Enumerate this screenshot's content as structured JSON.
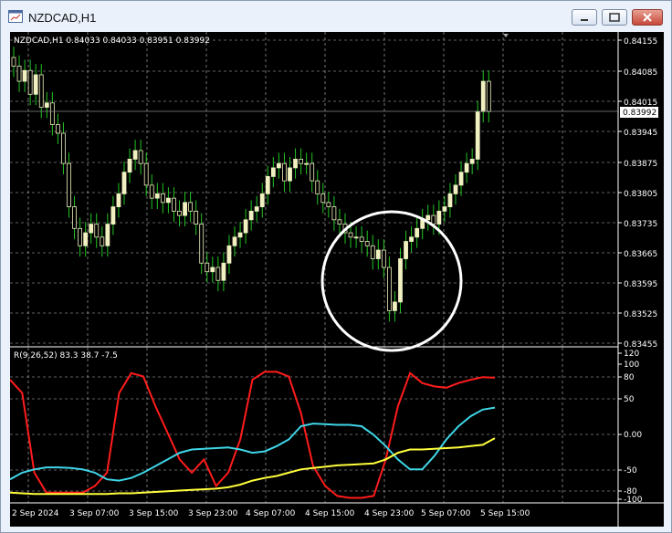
{
  "window": {
    "title": "NZDCAD,H1",
    "icons": {
      "app": "chart-window-icon",
      "minimize": "minimize-icon",
      "maximize": "maximize-icon",
      "close": "close-icon"
    }
  },
  "chart": {
    "header": "NZDCAD,H1  0.84033 0.84033 0.83951 0.83992",
    "price_label": "0.83992",
    "price_ticks": [
      "0.84155",
      "0.84085",
      "0.84015",
      "0.83945",
      "0.83875",
      "0.83805",
      "0.83735",
      "0.83665",
      "0.83595",
      "0.83525",
      "0.83455"
    ],
    "time_ticks": [
      "2 Sep 2024",
      "3 Sep 07:00",
      "3 Sep 15:00",
      "3 Sep 23:00",
      "4 Sep 07:00",
      "4 Sep 15:00",
      "4 Sep 23:00",
      "5 Sep 07:00",
      "5 Sep 15:00"
    ],
    "colors": {
      "background": "#000000",
      "grid": "#c0c0c0",
      "candle": "#f0f0c0",
      "wick": "#22c522",
      "text": "#ffffff"
    }
  },
  "indicator": {
    "label": "R(9,26,52) 83.3 38.7 -7.5",
    "ticks": [
      "120",
      "100",
      "80",
      "50",
      "0.00",
      "-50",
      "-80",
      "-100"
    ],
    "colors": {
      "red": "#ff1c1c",
      "cyan": "#3fd6e8",
      "yellow": "#ffff3c"
    }
  },
  "chart_data": [
    {
      "type": "line",
      "x": [
        0,
        2,
        4,
        6,
        8,
        10,
        12,
        14,
        16,
        18,
        20,
        22,
        24,
        26,
        28,
        30,
        32,
        34,
        36,
        38,
        40,
        42,
        44,
        46,
        48,
        50,
        52,
        54,
        56,
        58,
        60,
        62,
        64,
        66,
        68,
        70,
        72,
        74,
        76,
        78,
        80
      ],
      "series": [
        {
          "values": [
            80,
            60,
            -60,
            -90,
            -90,
            -90,
            -90,
            -80,
            -60,
            60,
            90,
            85,
            40,
            0,
            -40,
            -60,
            -40,
            -80,
            -60,
            -10,
            80,
            92,
            92,
            85,
            30,
            -50,
            -80,
            -95,
            -98,
            -98,
            -95,
            -40,
            40,
            90,
            75,
            70,
            68,
            75,
            80,
            84,
            83
          ]
        },
        {
          "values": [
            -70,
            -60,
            -55,
            -52,
            -52,
            -53,
            -55,
            -60,
            -70,
            -72,
            -68,
            -60,
            -50,
            -40,
            -30,
            -25,
            -24,
            -23,
            -22,
            -25,
            -30,
            -28,
            -20,
            -10,
            10,
            14,
            13,
            12,
            12,
            10,
            -3,
            -20,
            -40,
            -55,
            -55,
            -35,
            -10,
            10,
            25,
            35,
            38
          ]
        },
        {
          "values": [
            -90,
            -91,
            -92,
            -92,
            -92,
            -92,
            -92,
            -92,
            -92,
            -91,
            -91,
            -90,
            -89,
            -88,
            -87,
            -86,
            -85,
            -84,
            -82,
            -78,
            -72,
            -68,
            -65,
            -60,
            -55,
            -53,
            -51,
            -49,
            -48,
            -47,
            -46,
            -40,
            -30,
            -25,
            -25,
            -24,
            -23,
            -22,
            -20,
            -18,
            -8
          ]
        }
      ]
    }
  ]
}
